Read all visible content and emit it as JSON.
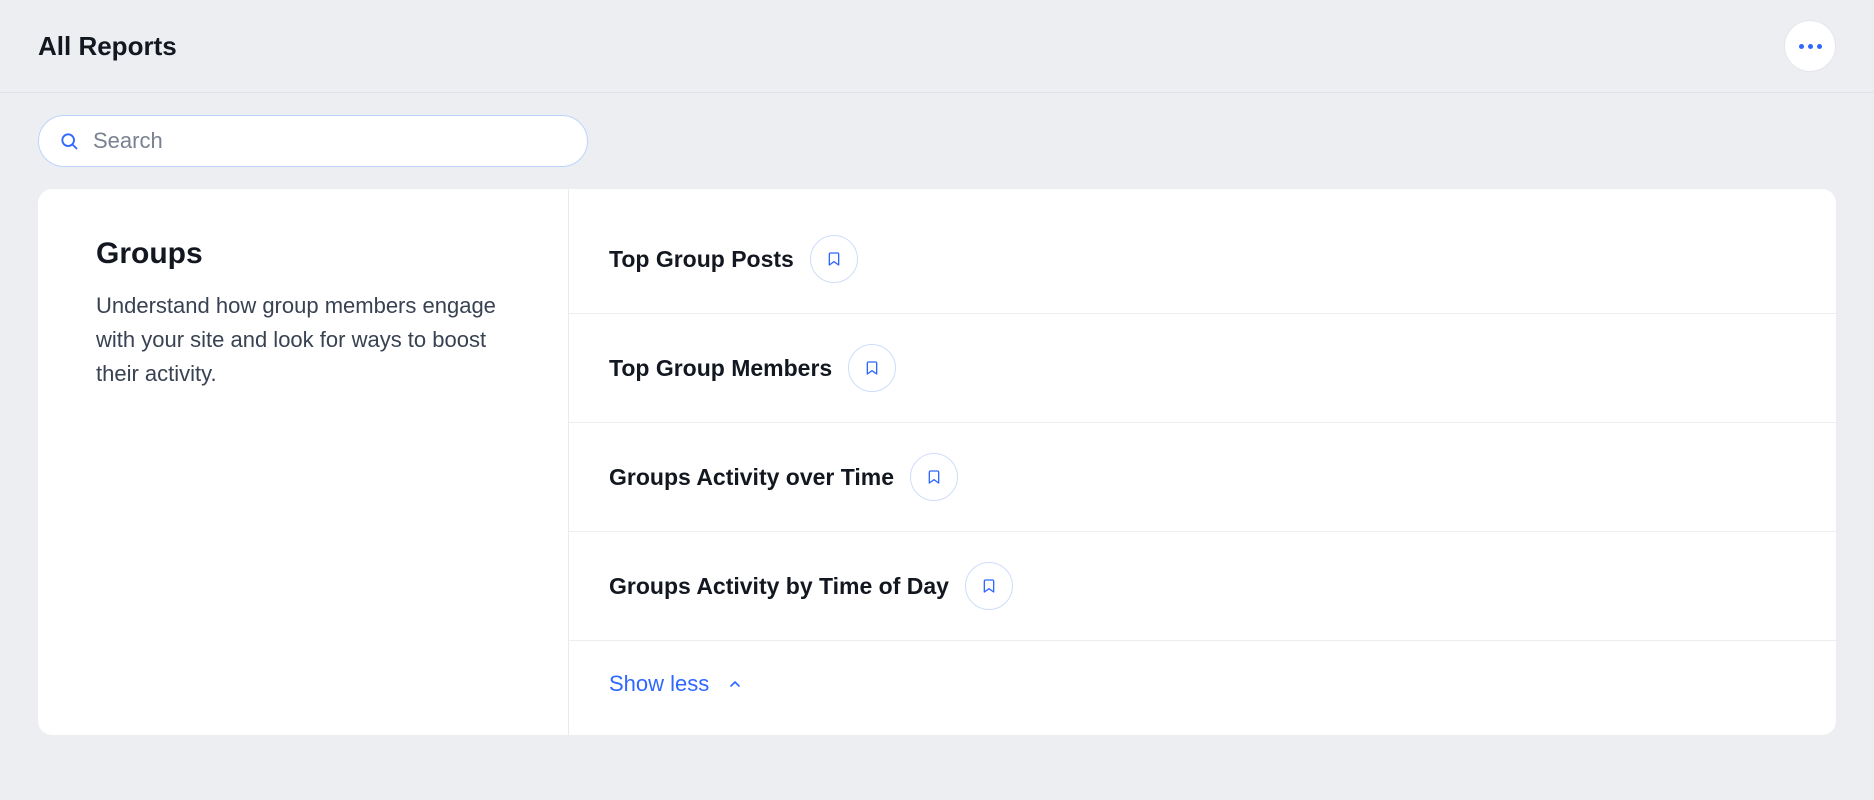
{
  "header": {
    "title": "All Reports"
  },
  "search": {
    "placeholder": "Search",
    "value": ""
  },
  "section": {
    "title": "Groups",
    "description": "Understand how group members engage with your site and look for ways to boost their activity."
  },
  "reports": [
    {
      "title": "Top Group Posts"
    },
    {
      "title": "Top Group Members"
    },
    {
      "title": "Groups Activity over Time"
    },
    {
      "title": "Groups Activity by Time of Day"
    }
  ],
  "controls": {
    "show_less_label": "Show less"
  }
}
